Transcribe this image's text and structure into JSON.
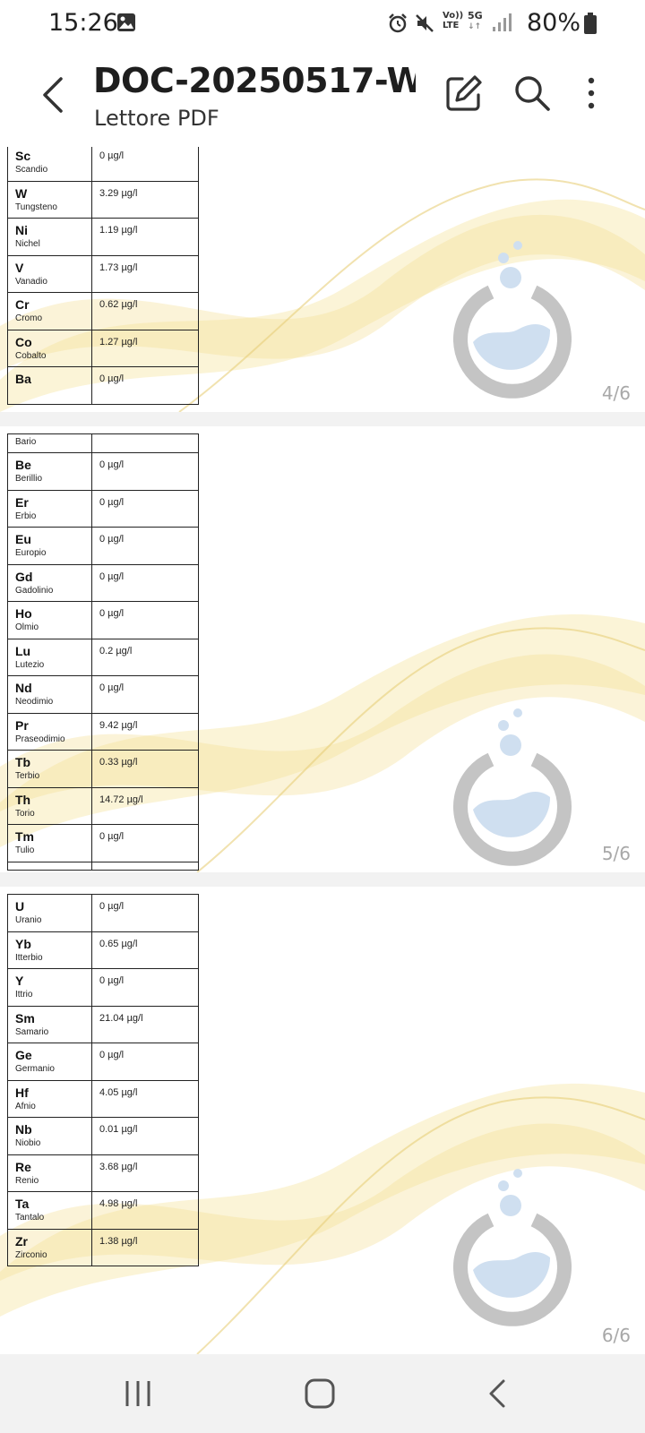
{
  "status": {
    "time": "15:26",
    "battery": "80%",
    "lte_label_top": "Vo))",
    "lte_label_bottom": "LTE",
    "net_label": "5G"
  },
  "app_bar": {
    "title": "DOC-20250517-W...",
    "subtitle": "Lettore PDF"
  },
  "pages": [
    {
      "page_label": "4/6",
      "rows": [
        {
          "symbol": "Sc",
          "name": "Scandio",
          "value": "0 µg/l"
        },
        {
          "symbol": "W",
          "name": "Tungsteno",
          "value": "3.29 µg/l"
        },
        {
          "symbol": "Ni",
          "name": "Nichel",
          "value": "1.19 µg/l"
        },
        {
          "symbol": "V",
          "name": "Vanadio",
          "value": "1.73 µg/l"
        },
        {
          "symbol": "Cr",
          "name": "Cromo",
          "value": "0.62 µg/l"
        },
        {
          "symbol": "Co",
          "name": "Cobalto",
          "value": "1.27 µg/l"
        },
        {
          "symbol": "Ba",
          "name": "",
          "value": "0 µg/l"
        }
      ]
    },
    {
      "page_label": "5/6",
      "rows": [
        {
          "symbol": "",
          "name": "Bario",
          "value": ""
        },
        {
          "symbol": "Be",
          "name": "Berillio",
          "value": "0 µg/l"
        },
        {
          "symbol": "Er",
          "name": "Erbio",
          "value": "0 µg/l"
        },
        {
          "symbol": "Eu",
          "name": "Europio",
          "value": "0 µg/l"
        },
        {
          "symbol": "Gd",
          "name": "Gadolinio",
          "value": "0 µg/l"
        },
        {
          "symbol": "Ho",
          "name": "Olmio",
          "value": "0 µg/l"
        },
        {
          "symbol": "Lu",
          "name": "Lutezio",
          "value": "0.2 µg/l"
        },
        {
          "symbol": "Nd",
          "name": "Neodimio",
          "value": "0 µg/l"
        },
        {
          "symbol": "Pr",
          "name": "Praseodimio",
          "value": "9.42 µg/l"
        },
        {
          "symbol": "Tb",
          "name": "Terbio",
          "value": "0.33 µg/l"
        },
        {
          "symbol": "Th",
          "name": "Torio",
          "value": "14.72 µg/l"
        },
        {
          "symbol": "Tm",
          "name": "Tulio",
          "value": "0 µg/l"
        }
      ]
    },
    {
      "page_label": "6/6",
      "rows": [
        {
          "symbol": "U",
          "name": "Uranio",
          "value": "0 µg/l"
        },
        {
          "symbol": "Yb",
          "name": "Itterbio",
          "value": "0.65 µg/l"
        },
        {
          "symbol": "Y",
          "name": "Ittrio",
          "value": "0 µg/l"
        },
        {
          "symbol": "Sm",
          "name": "Samario",
          "value": "21.04 µg/l"
        },
        {
          "symbol": "Ge",
          "name": "Germanio",
          "value": "0 µg/l"
        },
        {
          "symbol": "Hf",
          "name": "Afnio",
          "value": "4.05 µg/l"
        },
        {
          "symbol": "Nb",
          "name": "Niobio",
          "value": "0.01 µg/l"
        },
        {
          "symbol": "Re",
          "name": "Renio",
          "value": "3.68 µg/l"
        },
        {
          "symbol": "Ta",
          "name": "Tantalo",
          "value": "4.98 µg/l"
        },
        {
          "symbol": "Zr",
          "name": "Zirconio",
          "value": "1.38 µg/l"
        }
      ]
    }
  ],
  "icons": {
    "back": "back-arrow-icon",
    "edit": "edit-pencil-icon",
    "search": "search-icon",
    "more": "more-vertical-icon",
    "nav_recents": "recent-apps-icon",
    "nav_home": "home-icon",
    "nav_back": "back-icon"
  },
  "colors": {
    "logo_ring": "#c4c4c4",
    "logo_water": "#cfdff0",
    "wave": "#f3dd8e",
    "page_number": "#a8a8a8"
  }
}
